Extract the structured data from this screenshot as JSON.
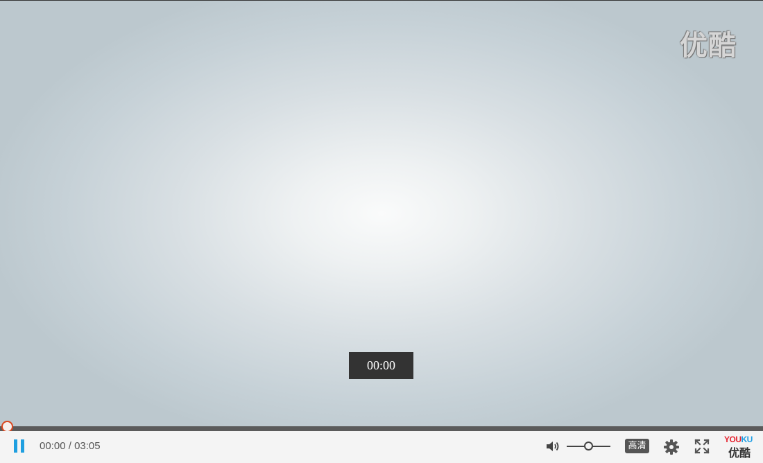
{
  "watermark": {
    "text": "优酷"
  },
  "tooltip": {
    "time": "00:00"
  },
  "progress": {
    "fraction": 0.0
  },
  "controls": {
    "current_time": "00:00",
    "separator": "/",
    "duration": "03:05",
    "volume_fraction": 0.5,
    "quality_label": "高清"
  },
  "logo": {
    "en_part1": "YOU",
    "en_part2": "KU",
    "cn": "优酷"
  },
  "icons": {
    "play_state": "pause-icon",
    "volume": "volume-icon",
    "settings": "gear-icon",
    "fullscreen": "fullscreen-icon"
  },
  "colors": {
    "accent": "#1f9fe0",
    "progress": "#e0400f",
    "youku_red": "#e5222e",
    "youku_blue": "#1e9fe5"
  }
}
